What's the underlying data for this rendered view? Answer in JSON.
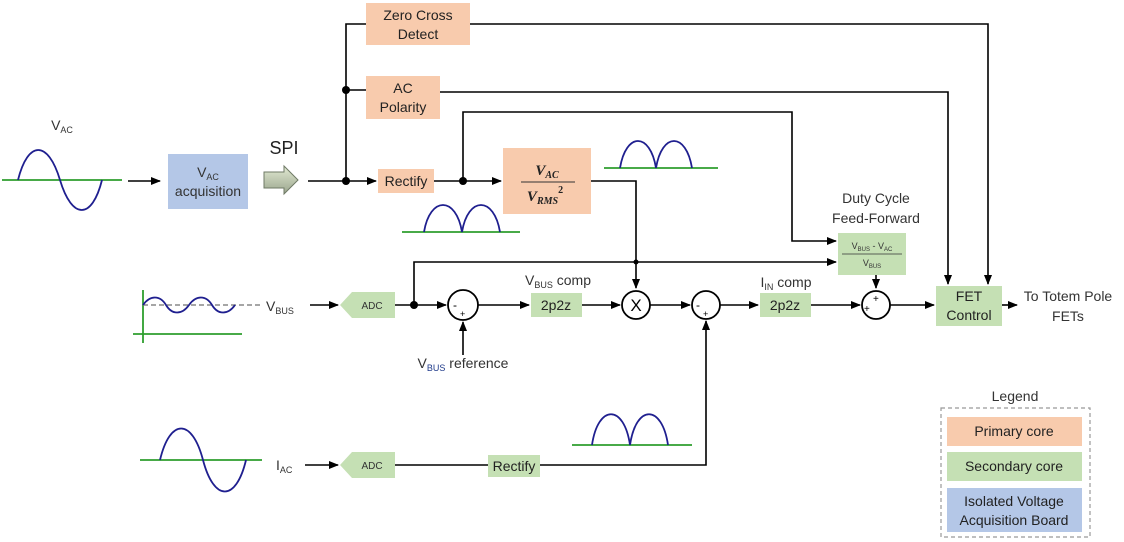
{
  "colors": {
    "primary_core": "#f8cbad",
    "secondary_core": "#c5e0b4",
    "isolated_board": "#b4c7e7",
    "waveform": "#1f1f8f",
    "waveform_axis": "#2e9e2e"
  },
  "blocks": {
    "zero_cross": [
      "Zero Cross",
      "Detect"
    ],
    "ac_polarity": [
      "AC",
      "Polarity"
    ],
    "rectify_top": "Rectify",
    "vac_norm": {
      "num_main": "V",
      "num_sub": "AC",
      "den_main": "V",
      "den_sub": "RMS",
      "den_sup": "2"
    },
    "vac_acq": {
      "main": "V",
      "sub": "AC",
      "line2": "acquisition"
    },
    "spi": "SPI",
    "vac_label": {
      "main": "V",
      "sub": "AC"
    },
    "vbus_label": {
      "main": "V",
      "sub": "BUS"
    },
    "iac_label": {
      "main": "I",
      "sub": "AC"
    },
    "adc_vbus": "ADC",
    "adc_iac": "ADC",
    "rectify_bottom": "Rectify",
    "vbus_comp": {
      "main": "V",
      "sub": "BUS",
      "rest": " comp",
      "box": "2p2z"
    },
    "iin_comp": {
      "main": "I",
      "sub": "IN",
      "rest": " comp",
      "box": "2p2z"
    },
    "vbus_ref": {
      "main": "V",
      "sub": "BUS",
      "rest": " reference"
    },
    "multiplier": "X",
    "duty_ff": {
      "title": [
        "Duty Cycle",
        "Feed-Forward"
      ],
      "num": {
        "a": "V",
        "a_sub": "BUS",
        "mid": " - V",
        "b_sub": "AC"
      },
      "den": {
        "a": "V",
        "a_sub": "BUS"
      }
    },
    "fet_control": [
      "FET",
      "Control"
    ],
    "output": [
      "To Totem Pole",
      "FETs"
    ],
    "sum1": {
      "minus": "-",
      "plus": "+"
    },
    "sum2": {
      "minus": "-",
      "plus": "+"
    },
    "sum3": {
      "plus_top": "+",
      "plus_left": "+"
    }
  },
  "legend": {
    "title": "Legend",
    "items": [
      {
        "label": "Primary core",
        "color": "#f8cbad"
      },
      {
        "label": "Secondary core",
        "color": "#c5e0b4"
      },
      {
        "label_lines": [
          "Isolated Voltage",
          "Acquisition Board"
        ],
        "color": "#b4c7e7"
      }
    ]
  }
}
